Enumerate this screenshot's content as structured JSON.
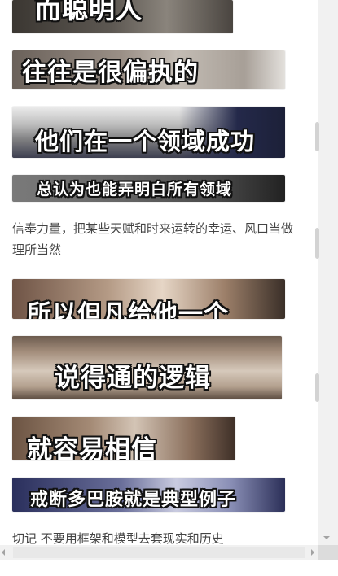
{
  "frames": [
    {
      "caption": "而聪明人"
    },
    {
      "caption": "往往是很偏执的"
    },
    {
      "caption": "他们在一个领域成功"
    },
    {
      "caption": "总认为也能弄明白所有领域"
    },
    {
      "caption": "所以但凡给他一个"
    },
    {
      "caption": "说得通的逻辑"
    },
    {
      "caption": "就容易相信"
    },
    {
      "caption": "戒断多巴胺就是典型例子"
    }
  ],
  "paragraphs": {
    "p1": "信奉力量，把某些天赋和时来运转的幸运、风口当做理所当然",
    "p2": "切记 不要用框架和模型去套现实和历史"
  }
}
